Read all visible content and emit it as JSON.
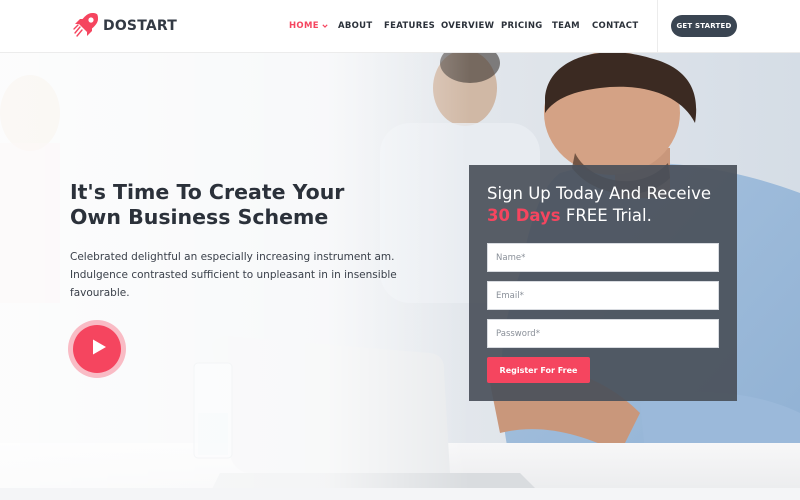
{
  "brand": {
    "name": "DOSTART",
    "logo_icon": "rocket-icon",
    "accent": "#f5455f",
    "dark": "#3a4552"
  },
  "nav": {
    "items": [
      {
        "label": "HOME",
        "active": true
      },
      {
        "label": "ABOUT"
      },
      {
        "label": "FEATURES"
      },
      {
        "label": "OVERVIEW"
      },
      {
        "label": "PRICING"
      },
      {
        "label": "TEAM"
      },
      {
        "label": "CONTACT"
      }
    ],
    "home_dropdown_icon": "chevron-down-icon",
    "cta_label": "GET STARTED"
  },
  "hero": {
    "title": "It's Time To Create Your Own Business Scheme",
    "description": "Celebrated delightful an especially increasing instrument am. Indulgence contrasted sufficient to unpleasant in in insensible favourable.",
    "play_icon": "play-icon"
  },
  "signup": {
    "title_part1": "Sign Up Today And Receive ",
    "title_highlight": "30 Days",
    "title_part2": " FREE Trial.",
    "name_placeholder": "Name*",
    "email_placeholder": "Email*",
    "password_placeholder": "Password*",
    "button_label": "Register For Free"
  }
}
